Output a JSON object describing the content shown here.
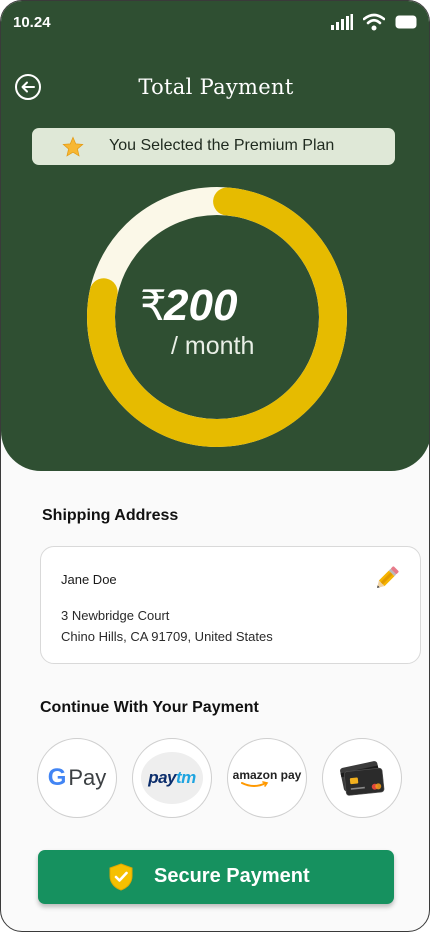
{
  "status_bar": {
    "time": "10.24"
  },
  "header": {
    "title": "Total Payment"
  },
  "plan_banner": {
    "text": "You Selected the Premium Plan"
  },
  "price": {
    "currency_symbol": "₹",
    "amount": "200",
    "period": "/ month",
    "ring_progress_fraction": 0.77,
    "ring_color": "#e6bb00",
    "ring_track_color": "#fbf8e8"
  },
  "shipping": {
    "label": "Shipping Address",
    "name": "Jane Doe",
    "line1": "3 Newbridge Court",
    "line2": "Chino Hills, CA 91709, United States"
  },
  "payment": {
    "label": "Continue With Your Payment",
    "options": [
      {
        "id": "gpay",
        "text_g": "G",
        "text_pay": "Pay"
      },
      {
        "id": "paytm",
        "text_pay": "pay",
        "text_tm": "tm"
      },
      {
        "id": "amazonpay",
        "text": "amazon pay"
      },
      {
        "id": "card",
        "icon": "credit-cards-icon"
      }
    ]
  },
  "cta": {
    "label": "Secure Payment"
  },
  "colors": {
    "hero_bg": "#2f4f32",
    "accent_green": "#16915f",
    "ring_gold": "#e6bb00"
  }
}
